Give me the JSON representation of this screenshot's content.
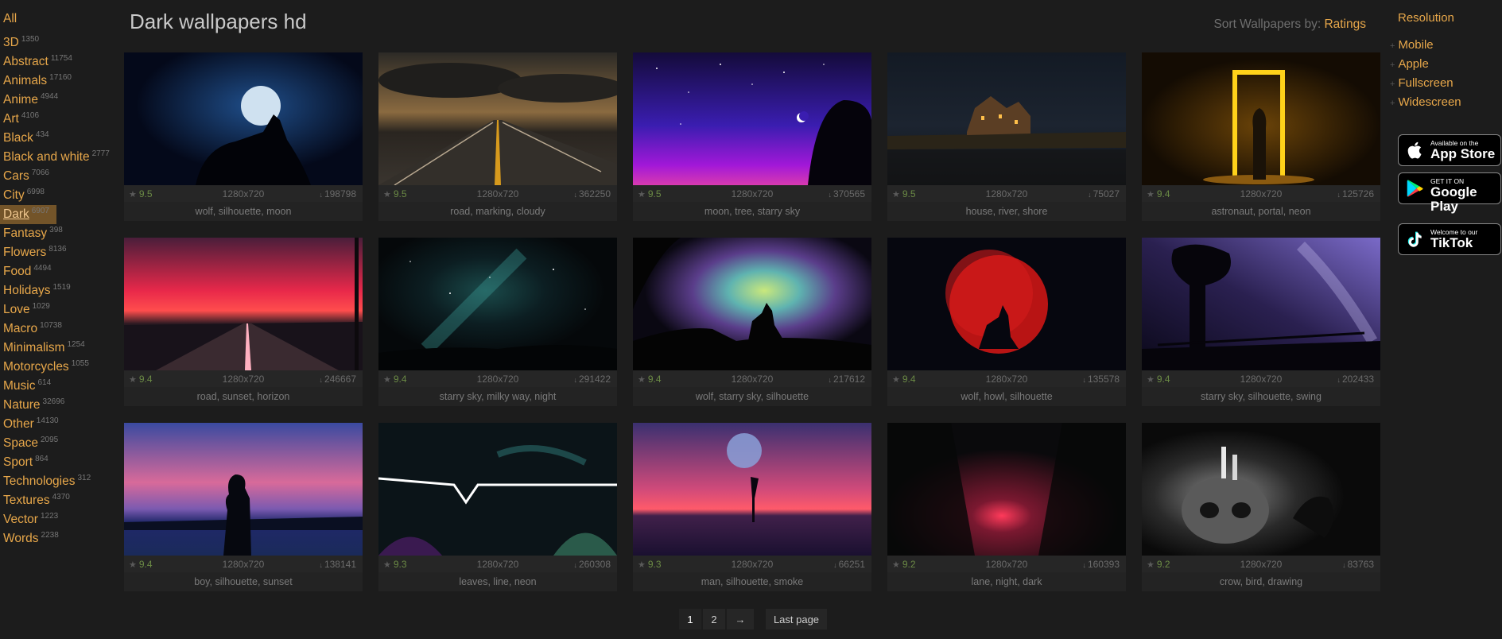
{
  "sidebar": {
    "all_label": "All",
    "categories": [
      {
        "label": "3D",
        "count": "1350"
      },
      {
        "label": "Abstract",
        "count": "11754"
      },
      {
        "label": "Animals",
        "count": "17160"
      },
      {
        "label": "Anime",
        "count": "4944"
      },
      {
        "label": "Art",
        "count": "4106"
      },
      {
        "label": "Black",
        "count": "434"
      },
      {
        "label": "Black and white",
        "count": "2777"
      },
      {
        "label": "Cars",
        "count": "7066"
      },
      {
        "label": "City",
        "count": "6998"
      },
      {
        "label": "Dark",
        "count": "6907"
      },
      {
        "label": "Fantasy",
        "count": "398"
      },
      {
        "label": "Flowers",
        "count": "8136"
      },
      {
        "label": "Food",
        "count": "4494"
      },
      {
        "label": "Holidays",
        "count": "1519"
      },
      {
        "label": "Love",
        "count": "1029"
      },
      {
        "label": "Macro",
        "count": "10738"
      },
      {
        "label": "Minimalism",
        "count": "1254"
      },
      {
        "label": "Motorcycles",
        "count": "1055"
      },
      {
        "label": "Music",
        "count": "614"
      },
      {
        "label": "Nature",
        "count": "32696"
      },
      {
        "label": "Other",
        "count": "14130"
      },
      {
        "label": "Space",
        "count": "2095"
      },
      {
        "label": "Sport",
        "count": "864"
      },
      {
        "label": "Technologies",
        "count": "312"
      },
      {
        "label": "Textures",
        "count": "4370"
      },
      {
        "label": "Vector",
        "count": "1223"
      },
      {
        "label": "Words",
        "count": "2238"
      }
    ],
    "active_index": 9
  },
  "header": {
    "title": "Dark wallpapers hd",
    "sort_label": "Sort Wallpapers by:",
    "sort_value": "Ratings"
  },
  "wallpapers": [
    {
      "rating": "9.5",
      "resolution": "1280x720",
      "downloads": "198798",
      "tags": "wolf, silhouette, moon",
      "scene": "wolf-moon"
    },
    {
      "rating": "9.5",
      "resolution": "1280x720",
      "downloads": "362250",
      "tags": "road, marking, cloudy",
      "scene": "road-cloudy"
    },
    {
      "rating": "9.5",
      "resolution": "1280x720",
      "downloads": "370565",
      "tags": "moon, tree, starry sky",
      "scene": "purple-moon"
    },
    {
      "rating": "9.5",
      "resolution": "1280x720",
      "downloads": "75027",
      "tags": "house, river, shore",
      "scene": "house-river"
    },
    {
      "rating": "9.4",
      "resolution": "1280x720",
      "downloads": "125726",
      "tags": "astronaut, portal, neon",
      "scene": "portal"
    },
    {
      "rating": "9.4",
      "resolution": "1280x720",
      "downloads": "246667",
      "tags": "road, sunset, horizon",
      "scene": "road-sunset"
    },
    {
      "rating": "9.4",
      "resolution": "1280x720",
      "downloads": "291422",
      "tags": "starry sky, milky way, night",
      "scene": "milky-way"
    },
    {
      "rating": "9.4",
      "resolution": "1280x720",
      "downloads": "217612",
      "tags": "wolf, starry sky, silhouette",
      "scene": "wolf-nebula"
    },
    {
      "rating": "9.4",
      "resolution": "1280x720",
      "downloads": "135578",
      "tags": "wolf, howl, silhouette",
      "scene": "red-moon"
    },
    {
      "rating": "9.4",
      "resolution": "1280x720",
      "downloads": "202433",
      "tags": "starry sky, silhouette, swing",
      "scene": "swing"
    },
    {
      "rating": "9.4",
      "resolution": "1280x720",
      "downloads": "138141",
      "tags": "boy, silhouette, sunset",
      "scene": "boy"
    },
    {
      "rating": "9.3",
      "resolution": "1280x720",
      "downloads": "260308",
      "tags": "leaves, line, neon",
      "scene": "leaves"
    },
    {
      "rating": "9.3",
      "resolution": "1280x720",
      "downloads": "66251",
      "tags": "man, silhouette, smoke",
      "scene": "smoke"
    },
    {
      "rating": "9.2",
      "resolution": "1280x720",
      "downloads": "160393",
      "tags": "lane, night, dark",
      "scene": "lane"
    },
    {
      "rating": "9.2",
      "resolution": "1280x720",
      "downloads": "83763",
      "tags": "crow, bird, drawing",
      "scene": "skull"
    }
  ],
  "right_sidebar": {
    "heading": "Resolution",
    "items": [
      "Mobile",
      "Apple",
      "Fullscreen",
      "Widescreen"
    ],
    "badges": [
      {
        "small": "Available on the",
        "big": "App Store",
        "icon": "apple-icon"
      },
      {
        "small": "GET IT ON",
        "big": "Google Play",
        "icon": "google-play-icon"
      },
      {
        "small": "Welcome to our",
        "big": "TikTok",
        "icon": "tiktok-icon"
      }
    ]
  },
  "pagination": {
    "pages": [
      "1",
      "2"
    ],
    "next": "→",
    "last": "Last page",
    "current": "1"
  },
  "colors": {
    "accent": "#e7a74a",
    "background": "#1c1c1c",
    "active_bg": "#735429",
    "rating": "#6b8a45"
  }
}
